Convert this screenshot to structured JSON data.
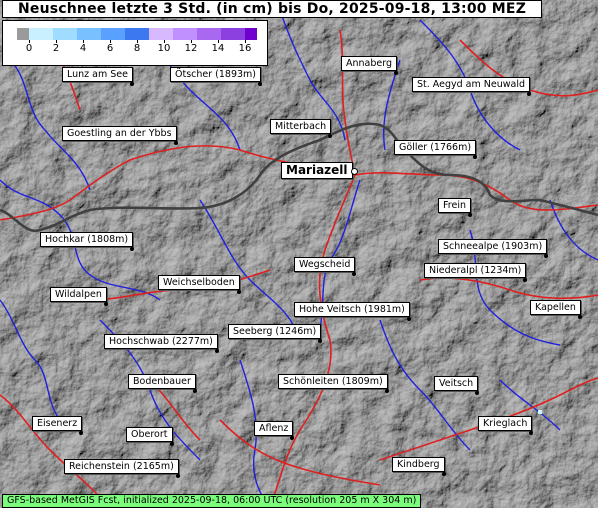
{
  "title": "Neuschnee letzte 3 Std. (in cm) bis Do, 2025-09-18, 13:00 MEZ",
  "legend": {
    "ticks": [
      "0",
      "2",
      "4",
      "6",
      "8",
      "10",
      "12",
      "14",
      "16"
    ],
    "colors": [
      "#9a9a9a",
      "#c8f0ff",
      "#a0dcff",
      "#78c0ff",
      "#5aa0ff",
      "#3c78f0",
      "#d8b8ff",
      "#c090ff",
      "#a868f0",
      "#8c40e0",
      "#7000d0"
    ]
  },
  "places": [
    {
      "name": "Annaberg"
    },
    {
      "name": "Lunz am See"
    },
    {
      "name": "Ötscher (1893m)"
    },
    {
      "name": "St. Aegyd am Neuwald"
    },
    {
      "name": "Goestling an der Ybbs"
    },
    {
      "name": "Mitterbach"
    },
    {
      "name": "Göller (1766m)"
    },
    {
      "name": "Mariazell"
    },
    {
      "name": "Frein"
    },
    {
      "name": "Hochkar (1808m)"
    },
    {
      "name": "Schneealpe (1903m)"
    },
    {
      "name": "Wegscheid"
    },
    {
      "name": "Niederalpl (1234m)"
    },
    {
      "name": "Weichselboden"
    },
    {
      "name": "Wildalpen"
    },
    {
      "name": "Hohe Veitsch (1981m)"
    },
    {
      "name": "Kapellen"
    },
    {
      "name": "Seeberg (1246m)"
    },
    {
      "name": "Hochschwab (2277m)"
    },
    {
      "name": "Bodenbauer"
    },
    {
      "name": "Schönleiten (1809m)"
    },
    {
      "name": "Veitsch"
    },
    {
      "name": "Eisenerz"
    },
    {
      "name": "Krieglach"
    },
    {
      "name": "Oberort"
    },
    {
      "name": "Aflenz"
    },
    {
      "name": "Reichenstein (2165m)"
    },
    {
      "name": "Kindberg"
    }
  ],
  "footer": "GFS-based MetGIS Fcst, initialized 2025-09-18, 06:00 UTC  (resolution 205 m X 304 m)"
}
